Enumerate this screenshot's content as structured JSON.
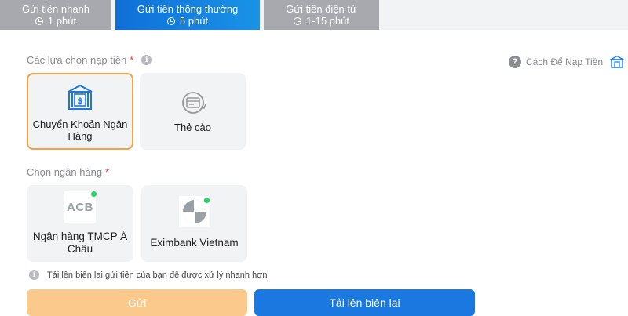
{
  "tabs": [
    {
      "title": "Gửi tiền nhanh",
      "time": "1 phút"
    },
    {
      "title": "Gửi tiền thông thường",
      "time": "5 phút"
    },
    {
      "title": "Gửi tiền điện tử",
      "time": "1-15 phút"
    }
  ],
  "deposit_options": {
    "label": "Các lựa chọn nạp tiền",
    "items": [
      {
        "label": "Chuyển Khoản Ngân Hàng"
      },
      {
        "label": "Thẻ cào"
      }
    ]
  },
  "help": {
    "label": "Cách Để Nạp Tiền"
  },
  "bank_section": {
    "label": "Chọn ngân hàng",
    "banks": [
      {
        "label": "Ngân hàng TMCP Á Châu",
        "logo_text": "ACB"
      },
      {
        "label": "Eximbank Vietnam"
      }
    ]
  },
  "note": "Tải lên biên lai gửi tiền của bạn để được xử lý nhanh hơn",
  "buttons": {
    "send": "Gửi",
    "upload": "Tải lên biên lai"
  },
  "colors": {
    "accent": "#1a78e0",
    "selected_border": "#f5a247",
    "send_button": "#fcc98d",
    "status_online": "#25d366"
  }
}
